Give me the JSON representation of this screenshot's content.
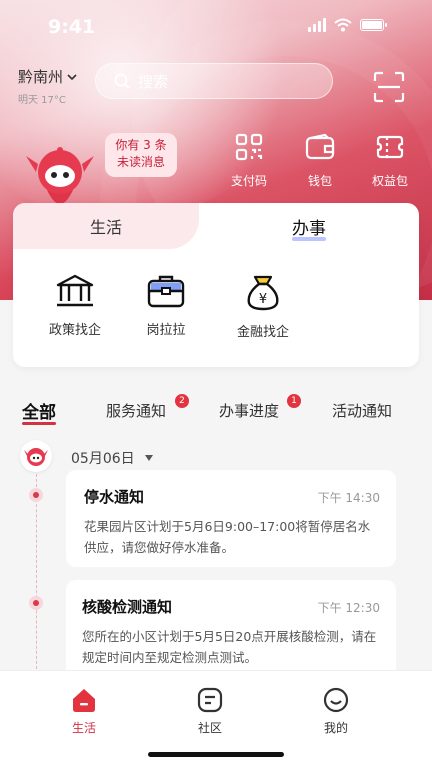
{
  "status_bar": {
    "time": "9:41"
  },
  "header": {
    "city": "黔南州",
    "weather": "明天 17°C",
    "search_placeholder": "搜索"
  },
  "mascot_bubble": {
    "line1": "你有 3 条",
    "line2": "未读消息"
  },
  "quick_actions": [
    {
      "label": "支付码",
      "icon": "qr-code-icon"
    },
    {
      "label": "钱包",
      "icon": "wallet-icon"
    },
    {
      "label": "权益包",
      "icon": "coupon-icon"
    }
  ],
  "service_card": {
    "tabs": [
      {
        "label": "生活",
        "active": false
      },
      {
        "label": "办事",
        "active": true
      }
    ],
    "services": [
      {
        "label": "政策找企",
        "icon": "bank-icon"
      },
      {
        "label": "岗拉拉",
        "icon": "briefcase-icon"
      },
      {
        "label": "金融找企",
        "icon": "money-bag-icon"
      }
    ]
  },
  "notice_tabs": [
    {
      "label": "全部",
      "active": true,
      "badge": ""
    },
    {
      "label": "服务通知",
      "active": false,
      "badge": "2"
    },
    {
      "label": "办事进度",
      "active": false,
      "badge": "1"
    },
    {
      "label": "活动通知",
      "active": false,
      "badge": ""
    }
  ],
  "timeline": {
    "date": "05月06日",
    "notices": [
      {
        "title": "停水通知",
        "time": "下午 14:30",
        "body": "花果园片区计划于5月6日9:00–17:00将暂停居名水供应，请您做好停水准备。"
      },
      {
        "title": "核酸检测通知",
        "time": "下午 12:30",
        "body": "您所在的小区计划于5月5日20点开展核酸检测，请在规定时间内至规定检测点测试。"
      }
    ]
  },
  "bottom_nav": [
    {
      "label": "生活",
      "active": true,
      "icon": "home-icon"
    },
    {
      "label": "社区",
      "active": false,
      "icon": "community-icon"
    },
    {
      "label": "我的",
      "active": false,
      "icon": "profile-icon"
    }
  ],
  "colors": {
    "brand": "#d33245",
    "hero_dark": "#c0233b",
    "hero_light": "#f6dfe2"
  }
}
